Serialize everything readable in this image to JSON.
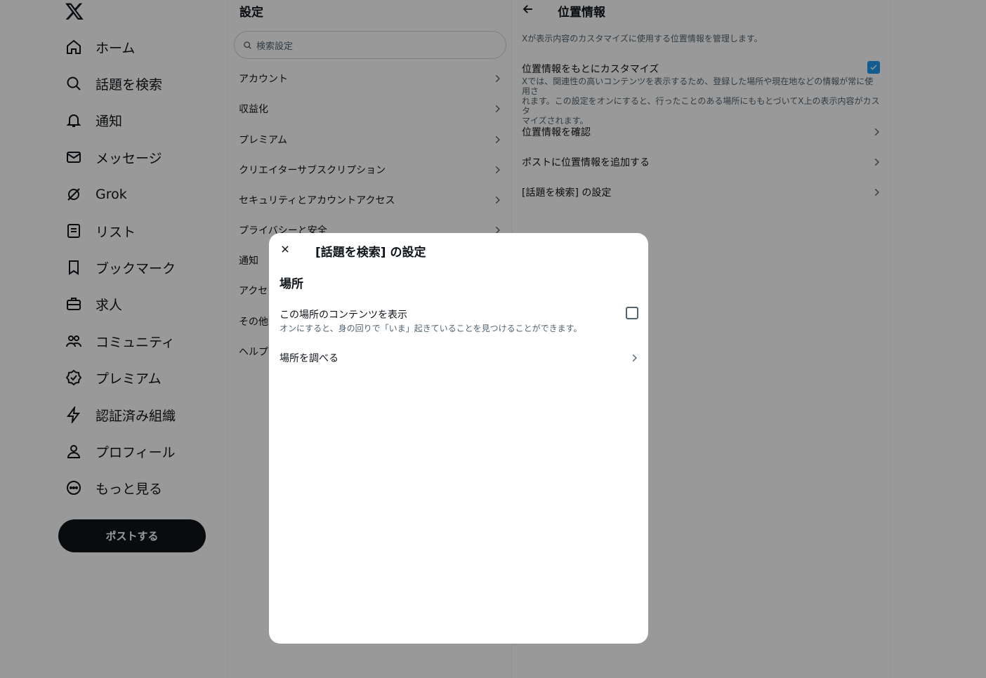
{
  "nav": {
    "items": [
      {
        "label": "ホーム",
        "icon": "home-icon"
      },
      {
        "label": "話題を検索",
        "icon": "search-icon"
      },
      {
        "label": "通知",
        "icon": "bell-icon"
      },
      {
        "label": "メッセージ",
        "icon": "mail-icon"
      },
      {
        "label": "Grok",
        "icon": "grok-icon"
      },
      {
        "label": "リスト",
        "icon": "list-icon"
      },
      {
        "label": "ブックマーク",
        "icon": "bookmark-icon"
      },
      {
        "label": "求人",
        "icon": "briefcase-icon"
      },
      {
        "label": "コミュニティ",
        "icon": "people-icon"
      },
      {
        "label": "プレミアム",
        "icon": "verified-icon"
      },
      {
        "label": "認証済み組織",
        "icon": "lightning-icon"
      },
      {
        "label": "プロフィール",
        "icon": "person-icon"
      },
      {
        "label": "もっと見る",
        "icon": "more-icon"
      }
    ],
    "post_button": "ポストする"
  },
  "settings": {
    "title": "設定",
    "search_placeholder": "検索設定",
    "items": [
      "アカウント",
      "収益化",
      "プレミアム",
      "クリエイターサブスクリプション",
      "セキュリティとアカウントアクセス",
      "プライバシーと安全",
      "通知",
      "アクセシビリティ",
      "その他のリソース",
      "ヘルプセンター"
    ]
  },
  "location": {
    "title": "位置情報",
    "description": "Xが表示内容のカスタマイズに使用する位置情報を管理します。",
    "customize": {
      "title": "位置情報をもとにカスタマイズ",
      "description_line1": "Xでは、関連性の高いコンテンツを表示するため、登録した場所や現在地などの情報が常に使用さ",
      "description_line2": "れます。この設定をオンにすると、行ったことのある場所にももとづいてX上の表示内容がカスタ",
      "description_line3": "マイズされます。",
      "checked": true
    },
    "rows": [
      "位置情報を確認",
      "ポストに位置情報を追加する",
      "[話題を検索] の設定"
    ]
  },
  "modal": {
    "title": "[話題を検索] の設定",
    "section": "場所",
    "option_title": "この場所のコンテンツを表示",
    "option_desc": "オンにすると、身の回りで「いま」起きていることを見つけることができます。",
    "option_checked": false,
    "row": "場所を調べる"
  },
  "colors": {
    "accent": "#1d9bf0",
    "text": "#0f1419",
    "secondary": "#536471",
    "overlay": "rgba(0,0,0,0.4)"
  }
}
